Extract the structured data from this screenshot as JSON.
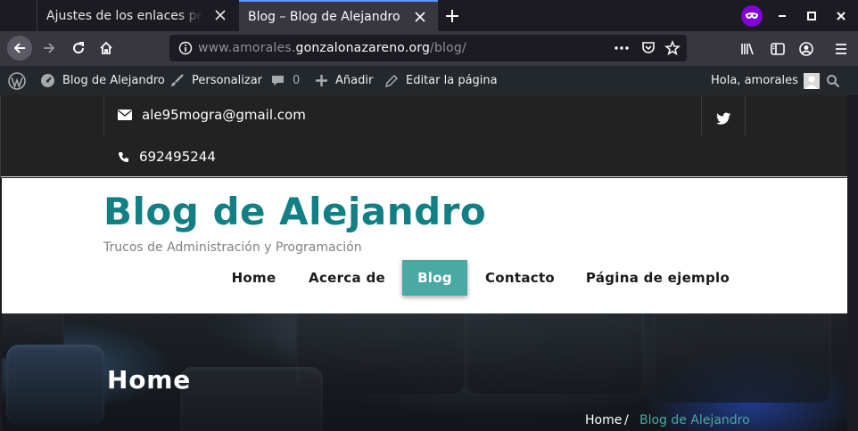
{
  "browser": {
    "tabs": [
      {
        "title": "Ajustes de los enlaces permanentes",
        "active": false
      },
      {
        "title": "Blog – Blog de Alejandro",
        "active": true
      }
    ],
    "url": {
      "prefix": "www.amorales.",
      "host": "gonzalonazareno.org",
      "path": "/blog/"
    },
    "accent_color": "#5b94ff",
    "private_color": "#8000d7"
  },
  "wp_admin_bar": {
    "site_name": "Blog de Alejandro",
    "customize": "Personalizar",
    "comments_count": "0",
    "add_new": "Añadir",
    "edit_page": "Editar la página",
    "greeting": "Hola, amorales"
  },
  "topbar": {
    "email": "ale95mogra@gmail.com",
    "phone": "692495244"
  },
  "site": {
    "title": "Blog de Alejandro",
    "tagline": "Trucos de Administración y Programación",
    "title_color": "#117f84",
    "accent_color": "#4aa9a2",
    "menu": [
      {
        "label": "Home",
        "active": false
      },
      {
        "label": "Acerca de",
        "active": false
      },
      {
        "label": "Blog",
        "active": true
      },
      {
        "label": "Contacto",
        "active": false
      },
      {
        "label": "Página de ejemplo",
        "active": false
      }
    ]
  },
  "hero": {
    "title": "Home",
    "breadcrumb": {
      "home": "Home",
      "separator": "/",
      "current": "Blog de Alejandro"
    }
  }
}
